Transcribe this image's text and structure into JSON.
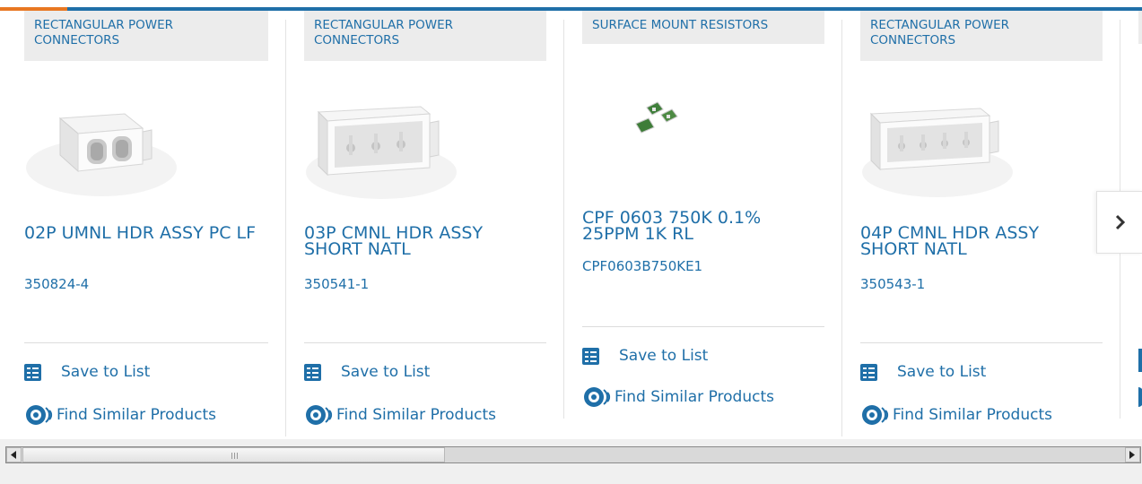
{
  "carousel": {
    "products": [
      {
        "category": "RECTANGULAR POWER CONNECTORS",
        "name": "02P UMNL HDR ASSY PC LF",
        "part_number": "350824-4",
        "image": "two-position-connector-image"
      },
      {
        "category": "RECTANGULAR POWER CONNECTORS",
        "name": "03P CMNL HDR ASSY SHORT NATL",
        "part_number": "350541-1",
        "image": "three-position-header-image"
      },
      {
        "category": "SURFACE MOUNT RESISTORS",
        "name": "CPF 0603 750K 0.1% 25PPM 1K RL",
        "part_number": "CPF0603B750KE1",
        "image": "smd-resistors-image"
      },
      {
        "category": "RECTANGULAR POWER CONNECTORS",
        "name": "04P CMNL HDR ASSY SHORT NATL",
        "part_number": "350543-1",
        "image": "four-position-header-image"
      }
    ],
    "actions": {
      "save": "Save to List",
      "similar": "Find Similar Products"
    },
    "next_icon": "chevron-right-icon"
  },
  "colors": {
    "brand_blue": "#1f6fa8",
    "accent_orange": "#e87722",
    "category_bg": "#ececec"
  }
}
